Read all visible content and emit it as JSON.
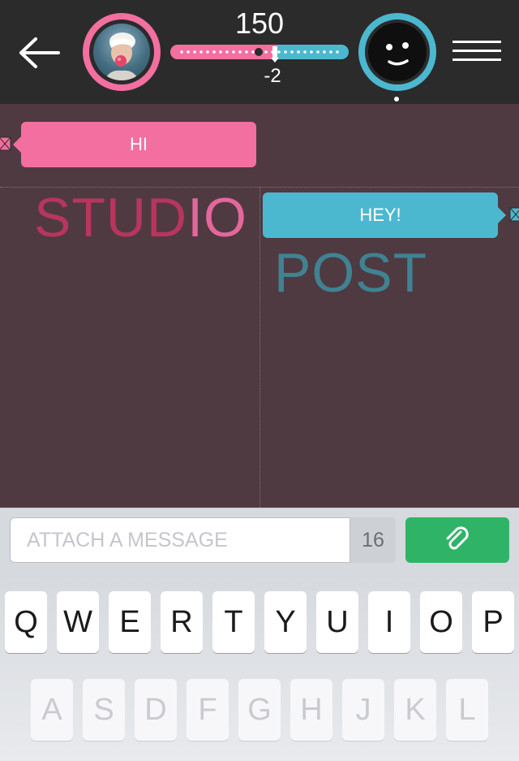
{
  "header": {
    "back_icon": "arrow-left-icon",
    "left_avatar_icon": "user-photo-avatar",
    "right_avatar_icon": "smiley-face-avatar",
    "menu_icon": "hamburger-menu-icon",
    "score_top": "150",
    "score_bottom": "-2",
    "colors": {
      "pink": "#f36f9f",
      "blue": "#4bb8cf",
      "bar": "#2b2b2b"
    }
  },
  "conversation": {
    "left_message": "HI",
    "right_message": "HEY!",
    "studio_label_part1": "STUD",
    "studio_label_part2": "IO",
    "post_label": "POST",
    "background": "#4f3a42"
  },
  "composer": {
    "placeholder": "ATTACH A MESSAGE",
    "char_count": "16",
    "attach_icon": "paperclip-icon",
    "attach_color": "#2fb467"
  },
  "keyboard": {
    "row1": [
      "Q",
      "W",
      "E",
      "R",
      "T",
      "Y",
      "U",
      "I",
      "O",
      "P"
    ],
    "row2": [
      "A",
      "S",
      "D",
      "F",
      "G",
      "H",
      "J",
      "K",
      "L"
    ]
  }
}
